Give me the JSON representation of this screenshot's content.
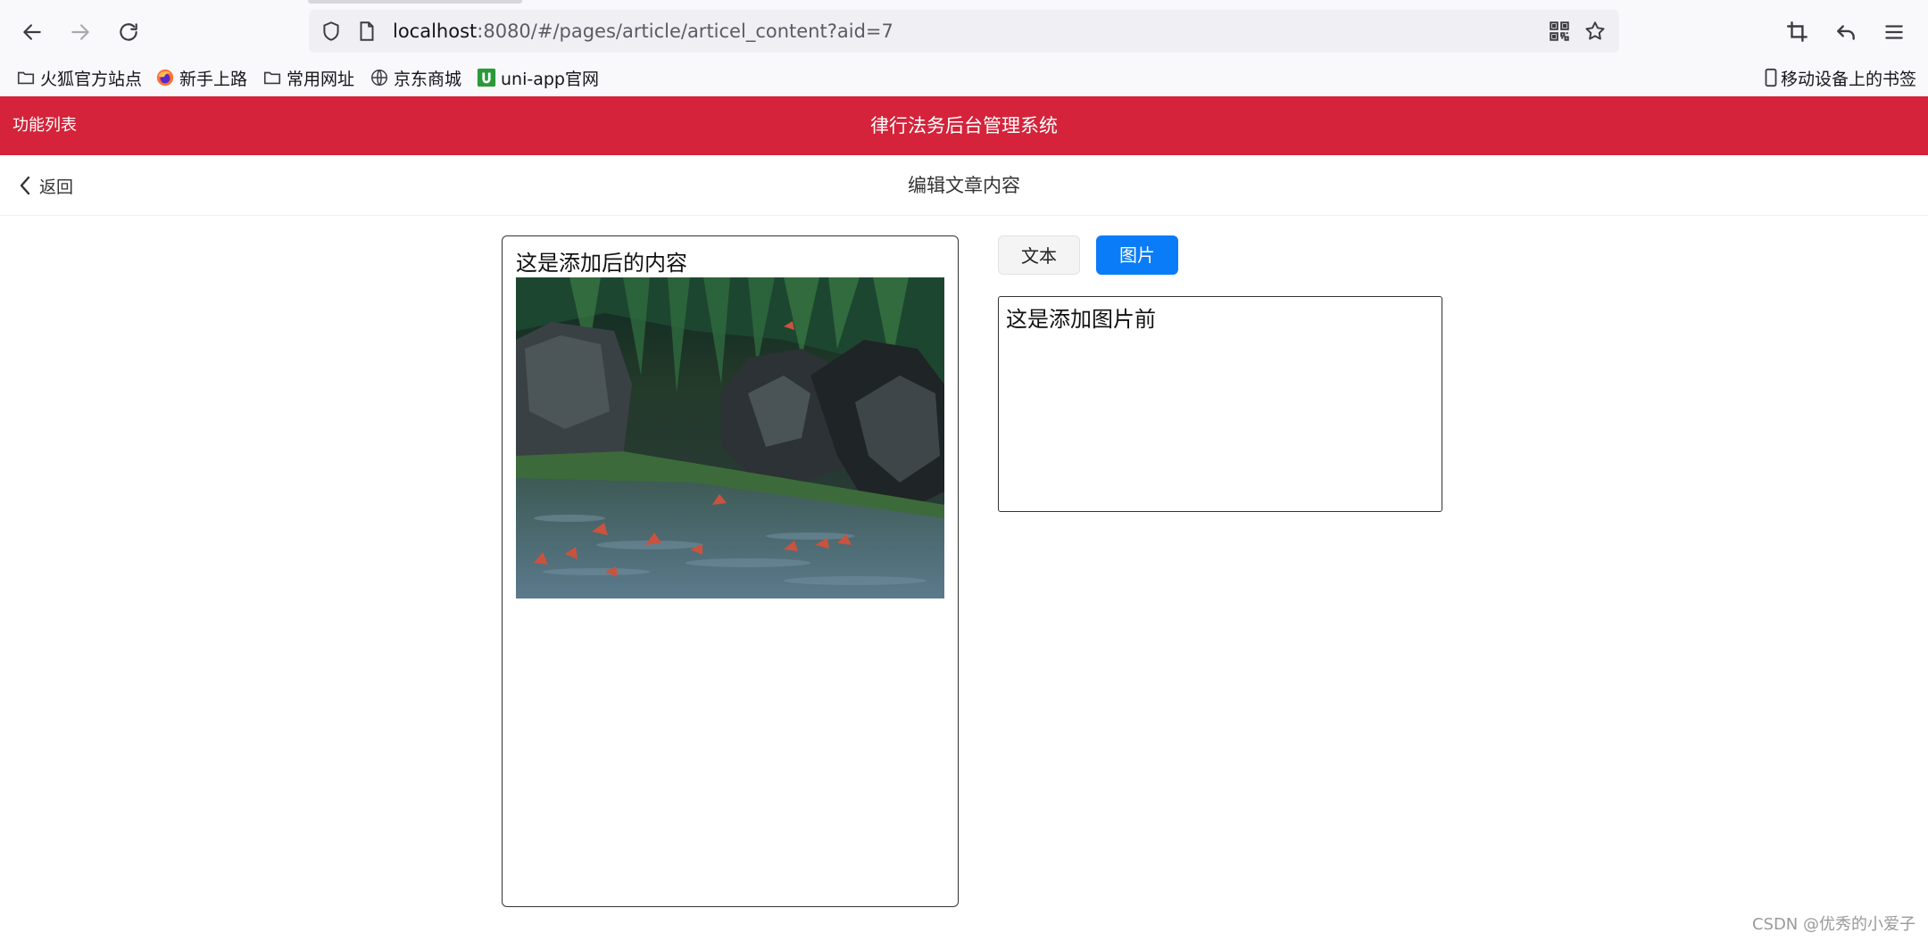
{
  "browser": {
    "url_host": "localhost",
    "url_path": ":8080/#/pages/article/articel_content?aid=7",
    "bookmarks": [
      {
        "label": "火狐官方站点",
        "icon": "folder-icon"
      },
      {
        "label": "新手上路",
        "icon": "firefox-icon"
      },
      {
        "label": "常用网址",
        "icon": "folder-icon"
      },
      {
        "label": "京东商城",
        "icon": "globe-icon"
      },
      {
        "label": "uni-app官网",
        "icon": "uniapp-icon"
      }
    ],
    "mobile_bookmarks": "移动设备上的书签"
  },
  "header": {
    "menu_label": "功能列表",
    "title": "律行法务后台管理系统",
    "color": "#d4233a"
  },
  "subnav": {
    "back_label": "返回",
    "title": "编辑文章内容"
  },
  "preview": {
    "text": "这是添加后的内容",
    "image_alt": "garden-stones-leaves-photo"
  },
  "editor": {
    "type_buttons": {
      "text": "文本",
      "image": "图片",
      "active": "image"
    },
    "content": "这是添加图片前"
  },
  "watermark": "CSDN @优秀的小爱子"
}
